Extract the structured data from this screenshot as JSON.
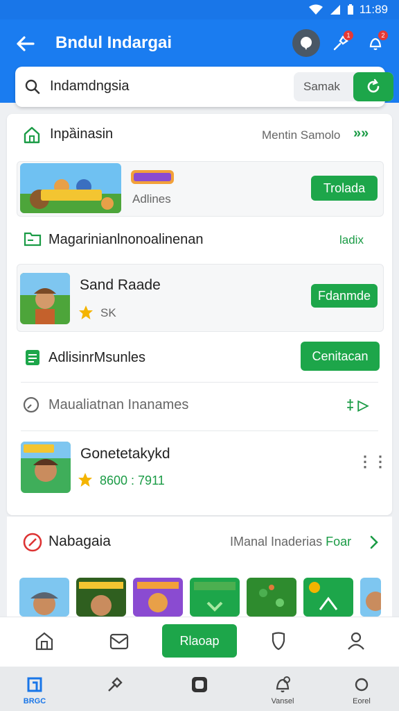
{
  "status": {
    "time": "11:89"
  },
  "header": {
    "title": "Bndul Indargai",
    "pin_badge": "1",
    "bell_badge": "2"
  },
  "search": {
    "value": "Indamdngsia",
    "mode_label": "Samak"
  },
  "section1": {
    "title": "Inpȁinasin",
    "link": "Mentin Samolo",
    "link_arrows": "»»"
  },
  "featured": {
    "subtitle": "Adlines",
    "action": "Trolada"
  },
  "section2": {
    "title": "Magarinianlnonoalinenan",
    "badge": "ladix"
  },
  "game1": {
    "name": "Sand Raade",
    "rating": "SK",
    "action": "Fdanmde"
  },
  "section3": {
    "title": "AdlisinrMsunles",
    "action": "Cenitacan"
  },
  "section4": {
    "title": "Maualiatnan Inanames",
    "icon_text": "‡ ▷"
  },
  "game2": {
    "name": "Gonetetakykd",
    "rating": "8600 : 7911",
    "more": "⋮⋮"
  },
  "section5": {
    "title": "Nabagaia",
    "link_prefix": "IManal Inaderias",
    "link_accent": "Foar"
  },
  "toolbar": {
    "primary": "Rlaoap"
  },
  "nav": {
    "home_label": "BRGC",
    "bell_label": "Vansel",
    "settings_label": "Eorel"
  }
}
